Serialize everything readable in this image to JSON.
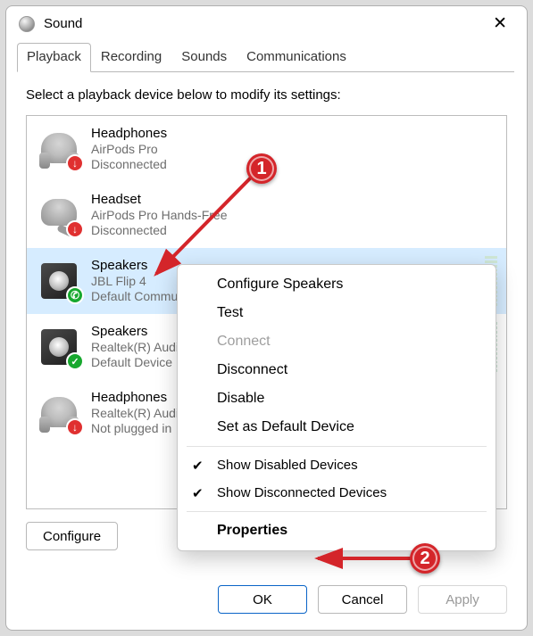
{
  "window": {
    "title": "Sound"
  },
  "tabs": {
    "items": [
      "Playback",
      "Recording",
      "Sounds",
      "Communications"
    ],
    "active_index": 0
  },
  "prompt": "Select a playback device below to modify its settings:",
  "devices": [
    {
      "name": "Headphones",
      "sub": "AirPods Pro",
      "status": "Disconnected",
      "icon": "headphones",
      "badge": "red",
      "selected": false,
      "level": false
    },
    {
      "name": "Headset",
      "sub": "AirPods Pro Hands-Free",
      "status": "Disconnected",
      "icon": "headset",
      "badge": "red",
      "selected": false,
      "level": false
    },
    {
      "name": "Speakers",
      "sub": "JBL Flip 4",
      "status": "Default Communications Device",
      "icon": "speaker",
      "badge": "phone",
      "selected": true,
      "level": true
    },
    {
      "name": "Speakers",
      "sub": "Realtek(R) Audio",
      "status": "Default Device",
      "icon": "speaker",
      "badge": "green",
      "selected": false,
      "level": true
    },
    {
      "name": "Headphones",
      "sub": "Realtek(R) Audio",
      "status": "Not plugged in",
      "icon": "headphones",
      "badge": "red",
      "selected": false,
      "level": false
    }
  ],
  "context_menu": {
    "items": [
      {
        "label": "Configure Speakers",
        "kind": "normal"
      },
      {
        "label": "Test",
        "kind": "normal"
      },
      {
        "label": "Connect",
        "kind": "disabled"
      },
      {
        "label": "Disconnect",
        "kind": "normal"
      },
      {
        "label": "Disable",
        "kind": "normal"
      },
      {
        "label": "Set as Default Device",
        "kind": "normal"
      },
      {
        "kind": "sep"
      },
      {
        "label": "Show Disabled Devices",
        "kind": "checked"
      },
      {
        "label": "Show Disconnected Devices",
        "kind": "checked"
      },
      {
        "kind": "sep"
      },
      {
        "label": "Properties",
        "kind": "bold"
      }
    ]
  },
  "buttons": {
    "configure": "Configure",
    "ok": "OK",
    "cancel": "Cancel",
    "apply": "Apply"
  },
  "annotations": {
    "one": "1",
    "two": "2"
  }
}
